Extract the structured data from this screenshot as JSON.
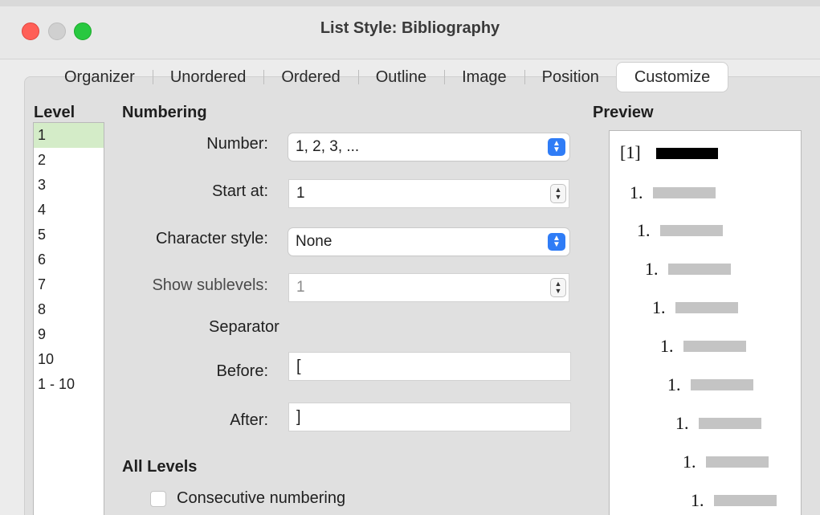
{
  "window": {
    "title": "List Style: Bibliography"
  },
  "tabs": [
    {
      "label": "Organizer"
    },
    {
      "label": "Unordered"
    },
    {
      "label": "Ordered"
    },
    {
      "label": "Outline"
    },
    {
      "label": "Image"
    },
    {
      "label": "Position"
    },
    {
      "label": "Customize",
      "active": true
    }
  ],
  "level": {
    "heading": "Level",
    "items": [
      "1",
      "2",
      "3",
      "4",
      "5",
      "6",
      "7",
      "8",
      "9",
      "10",
      "1 - 10"
    ],
    "selected": "1"
  },
  "numbering": {
    "heading": "Numbering",
    "number_label": "Number:",
    "number_value": "1, 2, 3, ...",
    "start_label": "Start at:",
    "start_value": "1",
    "charstyle_label": "Character style:",
    "charstyle_value": "None",
    "sublevels_label": "Show sublevels:",
    "sublevels_value": "1",
    "separator_label": "Separator",
    "before_label": "Before:",
    "before_value": "[",
    "after_label": "After:",
    "after_value": "]"
  },
  "all_levels": {
    "heading": "All Levels",
    "consecutive_label": "Consecutive numbering",
    "consecutive_checked": false
  },
  "preview": {
    "heading": "Preview",
    "first_label": "[1]",
    "sub_label": "1."
  },
  "colors": {
    "close": "#ff5f57",
    "minimize": "#d0d0d0",
    "maximize": "#28c840",
    "accent": "#2f7cf6",
    "selection": "#d4ecc8"
  },
  "icons": {
    "select_chevron": "up-down-chevron-icon",
    "stepper": "stepper-icon"
  }
}
